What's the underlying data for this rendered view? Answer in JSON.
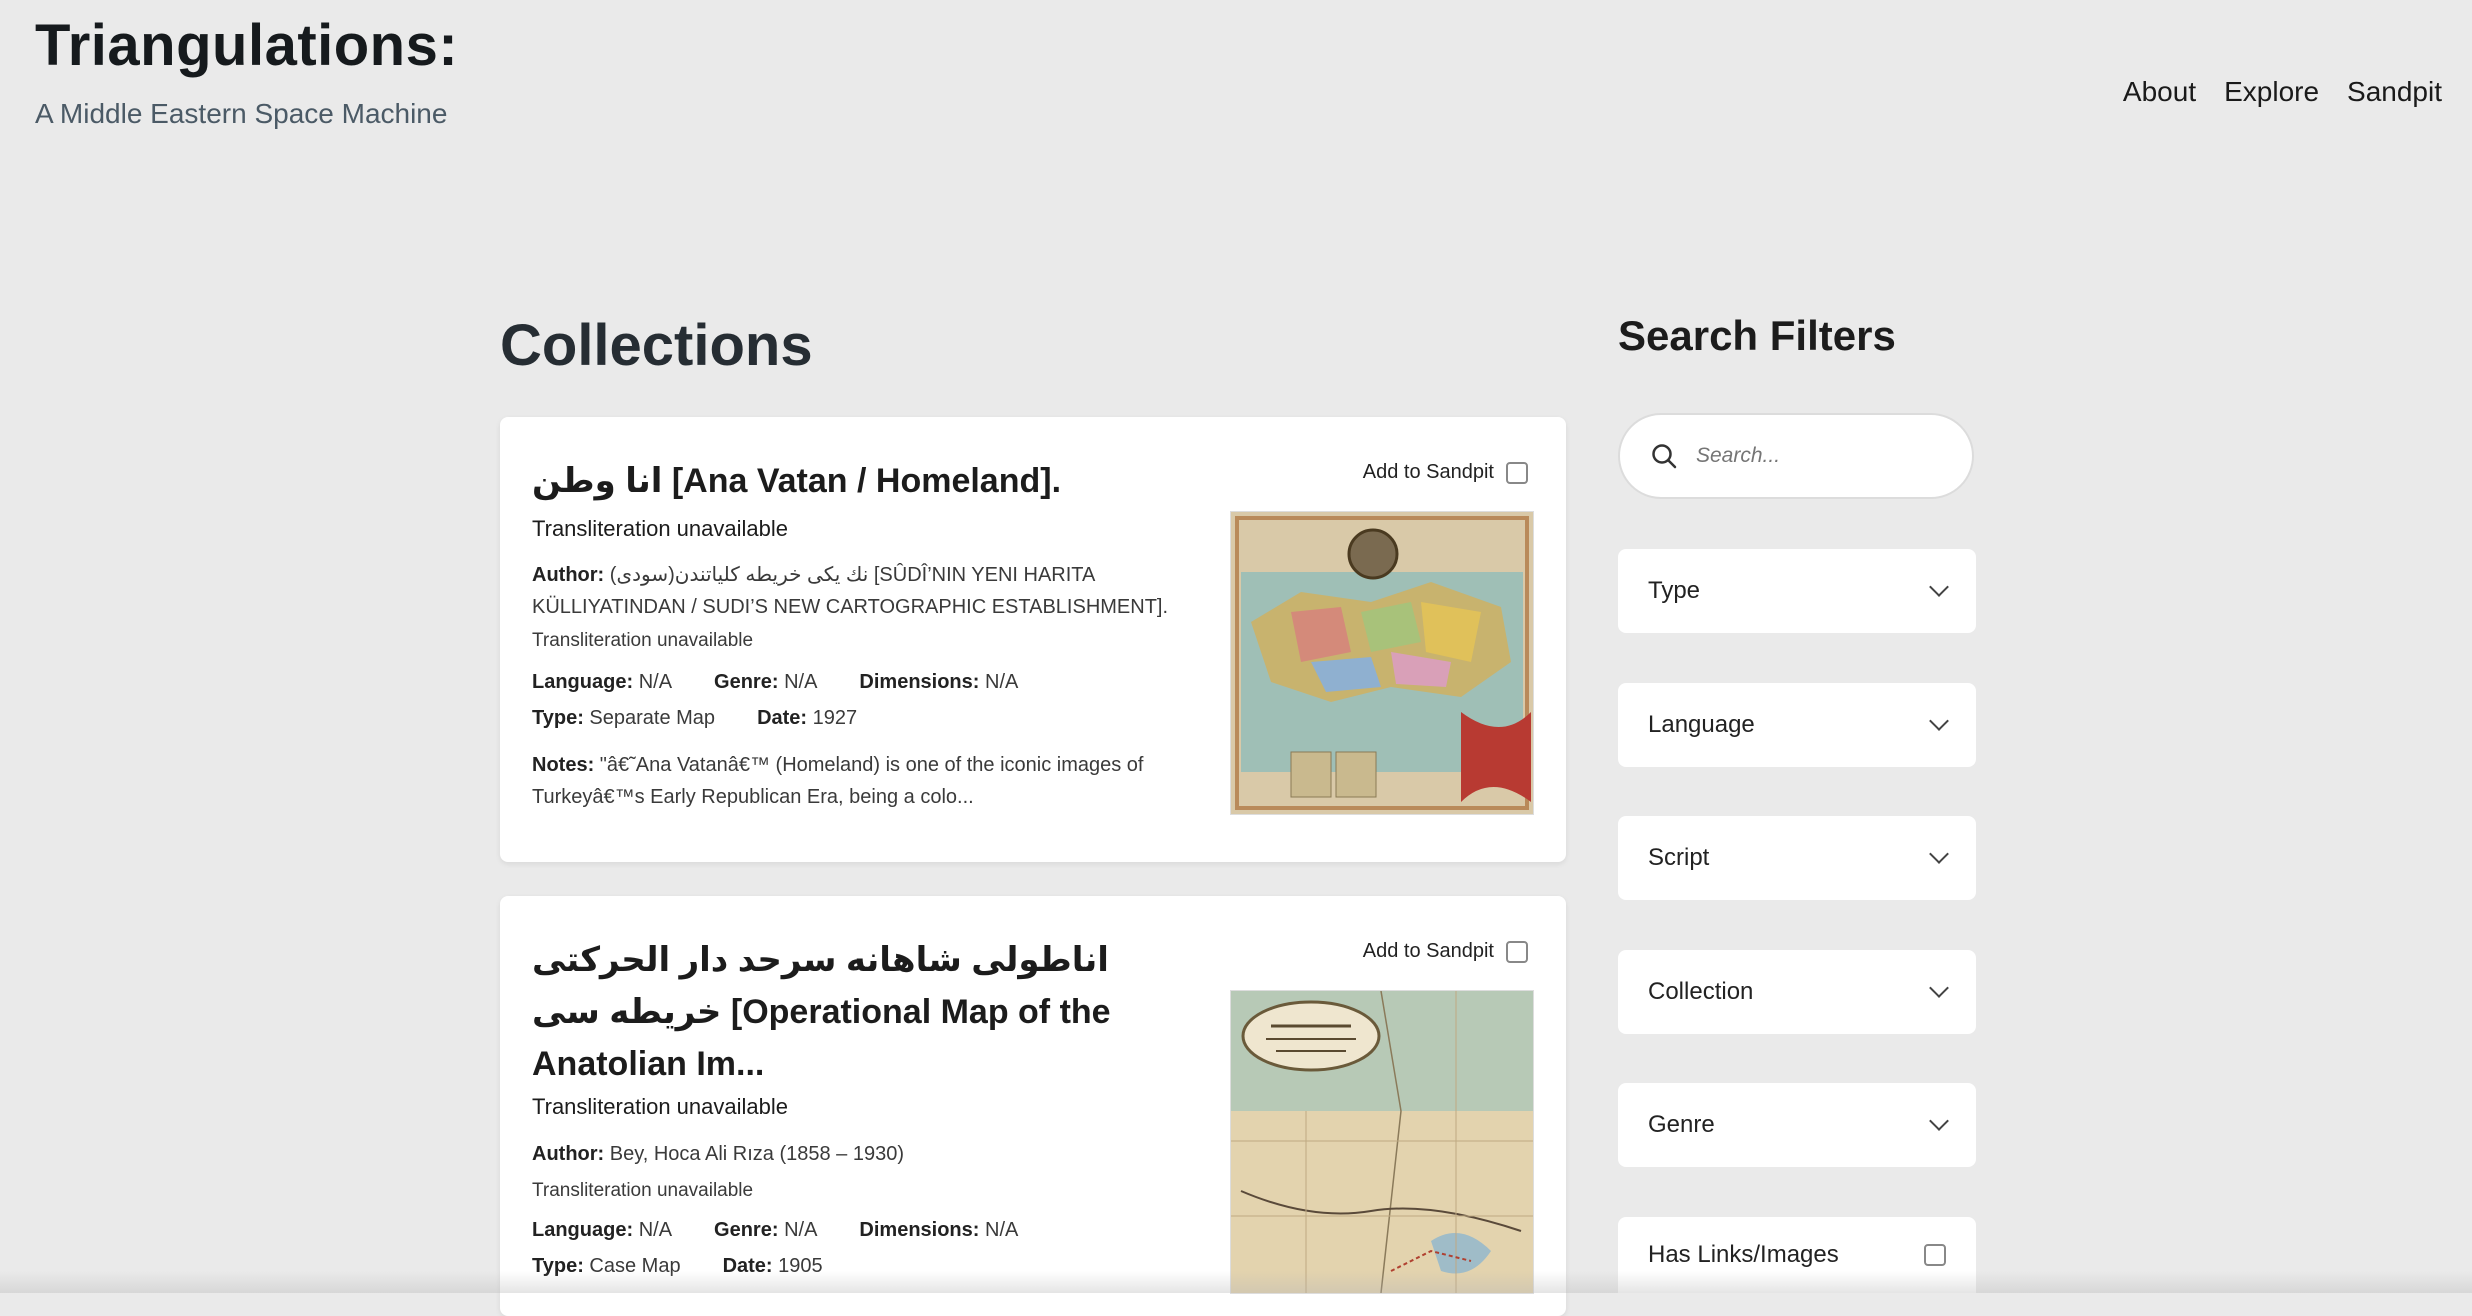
{
  "header": {
    "title": "Triangulations:",
    "subtitle": "A Middle Eastern Space Machine",
    "nav": [
      "About",
      "Explore",
      "Sandpit"
    ]
  },
  "main": {
    "heading": "Collections",
    "add_to_sandpit": "Add to Sandpit",
    "cards": [
      {
        "title": "انا وطن [Ana Vatan / Homeland].",
        "transliteration": "Transliteration unavailable",
        "author_label": "Author:",
        "author": "(سودی)نك يكى خريطه كلياتندن [SÛDÎ’NIN YENI HARITA KÜLLIYATINDAN / SUDI’S NEW CARTOGRAPHIC ESTABLISHMENT].",
        "author_transliteration": "Transliteration unavailable",
        "language_label": "Language:",
        "language": "N/A",
        "genre_label": "Genre:",
        "genre": "N/A",
        "dimensions_label": "Dimensions:",
        "dimensions": "N/A",
        "type_label": "Type:",
        "type": "Separate Map",
        "date_label": "Date:",
        "date": "1927",
        "notes_label": "Notes:",
        "notes": "\"â€˜Ana Vatanâ€™ (Homeland) is one of the iconic images of Turkeyâ€™s Early Republican Era, being a colo..."
      },
      {
        "title": "اناطولى شاهانه سرحد دار الحركتى خريطه سى [Operational Map of the Anatolian Im...",
        "transliteration": "Transliteration unavailable",
        "author_label": "Author:",
        "author": "Bey, Hoca Ali Rıza (1858 – 1930)",
        "author_transliteration": "Transliteration unavailable",
        "language_label": "Language:",
        "language": "N/A",
        "genre_label": "Genre:",
        "genre": "N/A",
        "dimensions_label": "Dimensions:",
        "dimensions": "N/A",
        "type_label": "Type:",
        "type": "Case Map",
        "date_label": "Date:",
        "date": "1905"
      }
    ]
  },
  "filters": {
    "title": "Search Filters",
    "search_placeholder": "Search...",
    "dropdowns": [
      "Type",
      "Language",
      "Script",
      "Collection",
      "Genre"
    ],
    "checkbox_label": "Has Links/Images"
  },
  "icons": {
    "search": "search-icon",
    "chevron": "chevron-down-icon"
  },
  "colors": {
    "background": "#eaeaea",
    "card": "#ffffff",
    "text": "#1f1f1f"
  }
}
